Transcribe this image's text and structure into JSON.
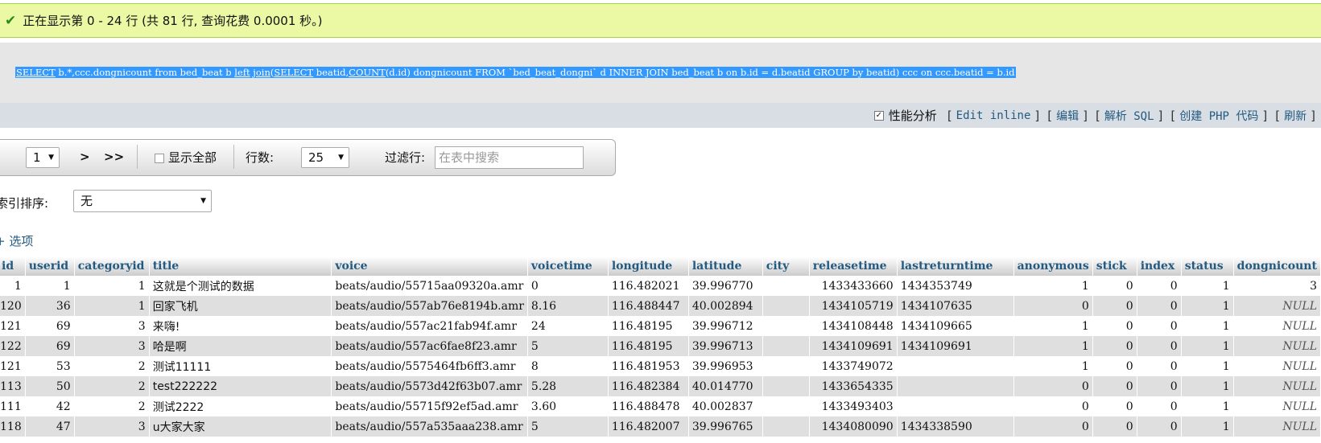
{
  "status": {
    "icon": "check-icon",
    "message": "正在显示第 0 - 24 行 (共 81 行, 查询花费 0.0001 秒。)"
  },
  "sql": {
    "parts": [
      "",
      "SELECT",
      " b.*,ccc.dongnicount from bed_beat b ",
      "left",
      " ",
      "join",
      "(",
      "SELECT",
      " beatid,",
      "COUNT",
      "(d.id) dongnicount FROM `bed_beat_dongni` d INNER JOIN bed_beat b on b.id = d.beatid GROUP by beatid) ccc on ccc.beatid = b.id"
    ]
  },
  "tools": {
    "profiling_label": "性能分析",
    "edit_inline": "Edit inline",
    "edit": "编辑",
    "explain": "解析 SQL",
    "create_php": "创建 PHP 代码",
    "refresh": "刷新"
  },
  "nav": {
    "page_value": "1",
    "next": ">",
    "last": ">>",
    "show_all": "显示全部",
    "rows_label": "行数:",
    "rows_value": "25",
    "filter_label": "过滤行:",
    "filter_placeholder": "在表中搜索"
  },
  "sort": {
    "label": "按索引排序:",
    "value": "无"
  },
  "options_link": "+ 选项",
  "table": {
    "columns": [
      "id",
      "userid",
      "categoryid",
      "title",
      "voice",
      "voicetime",
      "longitude",
      "latitude",
      "city",
      "releasetime",
      "lastreturntime",
      "anonymous",
      "stick",
      "index",
      "status",
      "dongnicount"
    ],
    "rows": [
      [
        "1",
        "1",
        "1",
        "这就是个测试的数据",
        "beats/audio/55715aa09320a.amr",
        "0",
        "116.482021",
        "39.996770",
        "",
        "1433433660",
        "1434353749",
        "1",
        "0",
        "0",
        "1",
        "3"
      ],
      [
        "120",
        "36",
        "1",
        "回家飞机",
        "beats/audio/557ab76e8194b.amr",
        "8.16",
        "116.488447",
        "40.002894",
        "",
        "1434105719",
        "1434107635",
        "0",
        "0",
        "0",
        "1",
        "NULL"
      ],
      [
        "121",
        "69",
        "3",
        "来嗨!",
        "beats/audio/557ac21fab94f.amr",
        "24",
        "116.48195",
        "39.996712",
        "",
        "1434108448",
        "1434109665",
        "1",
        "0",
        "0",
        "1",
        "NULL"
      ],
      [
        "122",
        "69",
        "3",
        "哈是啊",
        "beats/audio/557ac6fae8f23.amr",
        "5",
        "116.48195",
        "39.996713",
        "",
        "1434109691",
        "1434109691",
        "1",
        "0",
        "0",
        "1",
        "NULL"
      ],
      [
        "121",
        "53",
        "2",
        "测试11111",
        "beats/audio/5575464fb6ff3.amr",
        "8",
        "116.481953",
        "39.996953",
        "",
        "1433749072",
        "",
        "1",
        "0",
        "0",
        "1",
        "NULL"
      ],
      [
        "113",
        "50",
        "2",
        "test222222",
        "beats/audio/5573d42f63b07.amr",
        "5.28",
        "116.482384",
        "40.014770",
        "",
        "1433654335",
        "",
        "0",
        "0",
        "0",
        "1",
        "NULL"
      ],
      [
        "111",
        "42",
        "2",
        "测试2222",
        "beats/audio/55715f92ef5ad.amr",
        "3.60",
        "116.488478",
        "40.002837",
        "",
        "1433493403",
        "",
        "0",
        "0",
        "0",
        "1",
        "NULL"
      ],
      [
        "118",
        "47",
        "3",
        "u大家大家",
        "beats/audio/557a535aaa238.amr",
        "5",
        "116.482007",
        "39.996765",
        "",
        "1434080090",
        "1434338590",
        "0",
        "0",
        "0",
        "1",
        "NULL"
      ]
    ]
  }
}
